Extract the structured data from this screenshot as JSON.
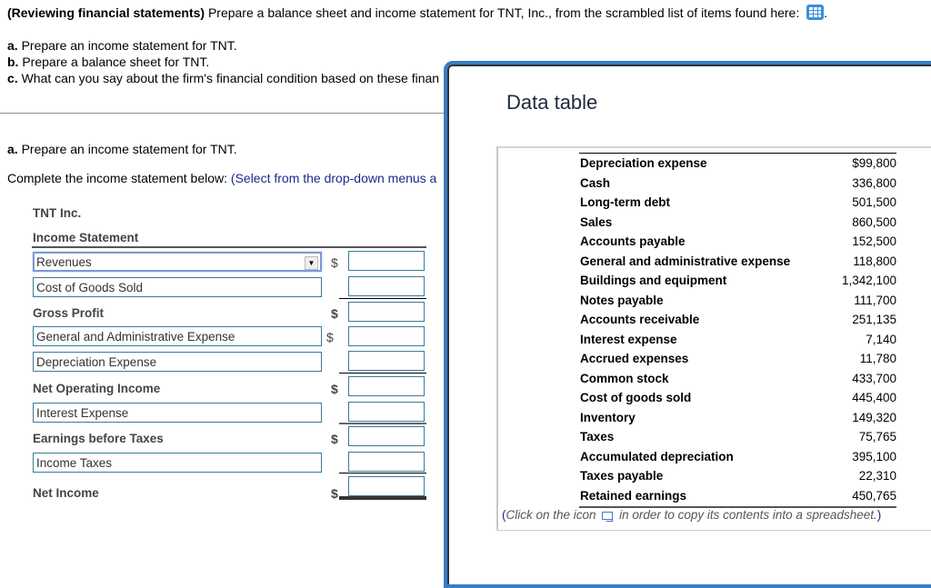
{
  "question": {
    "title_bold": "(Reviewing financial statements)",
    "title_text": " Prepare a balance sheet and income statement for TNT, Inc., from the scrambled list of items found here: ",
    "title_end": ".",
    "icon": "data-table-grid-icon",
    "parts": [
      {
        "letter": "a.",
        "text": " Prepare an income statement for TNT."
      },
      {
        "letter": "b.",
        "text": " Prepare a balance sheet for TNT."
      },
      {
        "letter": "c.",
        "text": " What can you say about the firm's financial condition based on these finan"
      }
    ]
  },
  "section": {
    "part_letter": "a.",
    "part_text": " Prepare an income statement for TNT.",
    "instruction": "Complete the income statement below:  ",
    "instruction_blue": "(Select from the drop-down menus a"
  },
  "income_statement": {
    "company": "TNT Inc.",
    "title": "Income Statement",
    "currency_symbol": "$",
    "rows": [
      {
        "label": "Revenues",
        "type": "select"
      },
      {
        "label": "Cost of Goods Sold",
        "type": "select"
      },
      {
        "label": "Gross Profit",
        "type": "subtotal"
      },
      {
        "label": "General and Administrative Expense",
        "type": "select"
      },
      {
        "label": "Depreciation Expense",
        "type": "select"
      },
      {
        "label": "Net Operating Income",
        "type": "subtotal"
      },
      {
        "label": "Interest Expense",
        "type": "select"
      },
      {
        "label": "Earnings before Taxes",
        "type": "subtotal"
      },
      {
        "label": "Income Taxes",
        "type": "select"
      },
      {
        "label": "Net Income",
        "type": "total"
      }
    ],
    "amounts": [
      "",
      "",
      "",
      "",
      "",
      "",
      "",
      "",
      "",
      ""
    ]
  },
  "modal": {
    "title": "Data table",
    "rows": [
      {
        "label": "Depreciation expense",
        "value": "$99,800"
      },
      {
        "label": "Cash",
        "value": "336,800"
      },
      {
        "label": "Long-term debt",
        "value": "501,500"
      },
      {
        "label": "Sales",
        "value": "860,500"
      },
      {
        "label": "Accounts payable",
        "value": "152,500"
      },
      {
        "label": "General and administrative expense",
        "value": "118,800"
      },
      {
        "label": "Buildings and equipment",
        "value": "1,342,100"
      },
      {
        "label": "Notes payable",
        "value": "111,700"
      },
      {
        "label": "Accounts receivable",
        "value": "251,135"
      },
      {
        "label": "Interest expense",
        "value": "7,140"
      },
      {
        "label": "Accrued expenses",
        "value": "11,780"
      },
      {
        "label": "Common stock",
        "value": "433,700"
      },
      {
        "label": "Cost of goods sold",
        "value": "445,400"
      },
      {
        "label": "Inventory",
        "value": "149,320"
      },
      {
        "label": "Taxes",
        "value": "75,765"
      },
      {
        "label": "Accumulated depreciation",
        "value": "395,100"
      },
      {
        "label": "Taxes payable",
        "value": "22,310"
      },
      {
        "label": "Retained earnings",
        "value": "450,765"
      }
    ],
    "note_open": "(",
    "note_pre": "Click on the icon ",
    "note_post": "  in order to copy its contents into a spreadsheet.",
    "note_close": ")"
  },
  "colors": {
    "accent": "#3a7cc4",
    "instruction_blue": "#1a2a8c",
    "input_border": "#3a7a9a"
  }
}
